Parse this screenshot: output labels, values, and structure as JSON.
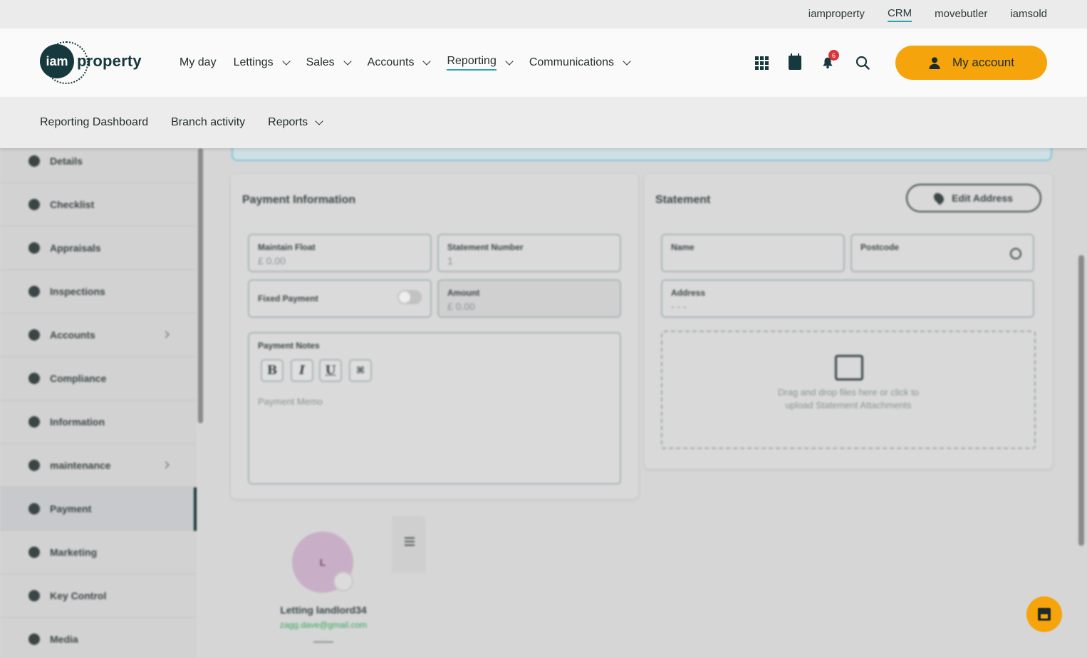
{
  "topbar": {
    "links": [
      "iamproperty",
      "CRM",
      "movebutler",
      "iamsold"
    ],
    "active": "CRM"
  },
  "logo": {
    "badge": "iam",
    "word": "property"
  },
  "nav": {
    "items": [
      {
        "label": "My day"
      },
      {
        "label": "Lettings"
      },
      {
        "label": "Sales"
      },
      {
        "label": "Accounts"
      },
      {
        "label": "Reporting"
      },
      {
        "label": "Communications"
      }
    ],
    "active": "Reporting"
  },
  "header_icons": {
    "apps": "apps-grid-icon",
    "calendar": "calendar-icon",
    "notifications": "bell-icon",
    "notification_count": "6",
    "search": "search-icon"
  },
  "account": {
    "label": "My account",
    "icon": "user-icon"
  },
  "subnav": {
    "items": [
      {
        "label": "Reporting Dashboard"
      },
      {
        "label": "Branch activity"
      },
      {
        "label": "Reports"
      }
    ]
  },
  "sidebar": {
    "items": [
      {
        "label": "Details",
        "icon": "home-icon"
      },
      {
        "label": "Checklist",
        "icon": "check-circle-icon"
      },
      {
        "label": "Appraisals",
        "icon": "house-icon"
      },
      {
        "label": "Inspections",
        "icon": "list-icon"
      },
      {
        "label": "Accounts",
        "icon": "wallet-icon"
      },
      {
        "label": "Compliance",
        "icon": "shield-icon"
      },
      {
        "label": "Information",
        "icon": "info-icon"
      },
      {
        "label": "maintenance",
        "icon": "wrench-icon"
      },
      {
        "label": "Payment",
        "icon": "payment-icon"
      },
      {
        "label": "Marketing",
        "icon": "bookmark-icon"
      },
      {
        "label": "Key Control",
        "icon": "key-icon"
      },
      {
        "label": "Media",
        "icon": "images-icon"
      }
    ],
    "active": "Payment"
  },
  "payment": {
    "title": "Payment Information",
    "maintain_float_label": "Maintain Float",
    "maintain_float_value": "£ 0.00",
    "statement_number_label": "Statement Number",
    "statement_number_value": "1",
    "fixed_payment_label": "Fixed Payment",
    "amount_label": "Amount",
    "amount_value": "£ 0.00",
    "notes_label": "Payment Notes",
    "format_buttons": [
      "B",
      "I",
      "U",
      "⌘"
    ],
    "notes_placeholder": "Payment Memo"
  },
  "statement": {
    "title": "Statement",
    "edit_address": "Edit Address",
    "name_label": "Name",
    "postcode_label": "Postcode",
    "address_label": "Address",
    "address_value": "- - -",
    "dropzone_line1": "Drag and drop files here or click to",
    "dropzone_line2": "upload Statement Attachments"
  },
  "contact": {
    "initial": "L",
    "name": "Letting landlord34",
    "email": "zagg.dave@gmail.com"
  },
  "colors": {
    "accent": "#f5a40b",
    "brand": "#16393d",
    "link_underline": "#2aa3b3",
    "badge": "#d9343a"
  }
}
